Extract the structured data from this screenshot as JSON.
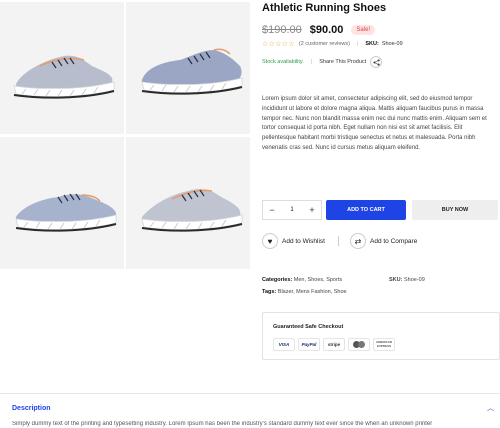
{
  "product": {
    "title": "Athletic Running Shoes",
    "old_price": "$190.00",
    "new_price": "$90.00",
    "sale_badge": "Sale!",
    "stars": "☆☆☆☆☆",
    "review_count": "(2 customer reviews)",
    "sku_label": "SKU:",
    "sku_value": "Shoe-09",
    "stock": "Stock availability.",
    "share_label": "Share This Product",
    "description": "Lorem ipsum dolor sit amet, consectetur adipiscing elit, sed do eiusmod tempor incididunt ut labore et dolore magna aliqua. Mattis aliquam faucibus purus in massa tempor nec. Nunc non blandit massa enim nec dui nunc mattis enim. Aliquam sem et tortor consequat id porta nibh. Eget nullam non nisi est sit amet facilisis. Elit pellentesque habitant morbi tristique senectus et netus et malesuada. Porta nibh venenatis cras sed. Nunc id cursus metus aliquam eleifend."
  },
  "purchase": {
    "qty_minus": "−",
    "qty_value": "1",
    "qty_plus": "+",
    "add_to_cart": "ADD TO CART",
    "buy_now": "BUY NOW"
  },
  "actions": {
    "wishlist": "Add to Wishlist",
    "compare": "Add to Compare"
  },
  "meta": {
    "categories_label": "Categories:",
    "categories_value": "Men, Shoes, Sports",
    "sku_label": "SKU:",
    "sku_value": "Shoe-09",
    "tags_label": "Tags:",
    "tags_value": "Blazer, Mens Fashion, Shoe"
  },
  "checkout": {
    "title": "Guaranteed Safe Checkout",
    "methods": [
      "VISA",
      "PayPal",
      "stripe",
      "",
      "AMERICAN EXPRESS"
    ]
  },
  "description_panel": {
    "heading": "Description",
    "text": "Simply dummy text of the printing and typesetting industry. Lorem Ipsum has been the industry's standard dummy text ever since the when an unknown printer"
  },
  "icons": {
    "share": "share-icon",
    "wishlist": "heart-icon",
    "compare": "compare-arrows-icon",
    "chevron": "chevron-up-icon"
  },
  "colors": {
    "accent": "#1e44e6",
    "sale": "#d8464d",
    "stock": "#2e9a4d",
    "stars": "#e0a43a"
  }
}
